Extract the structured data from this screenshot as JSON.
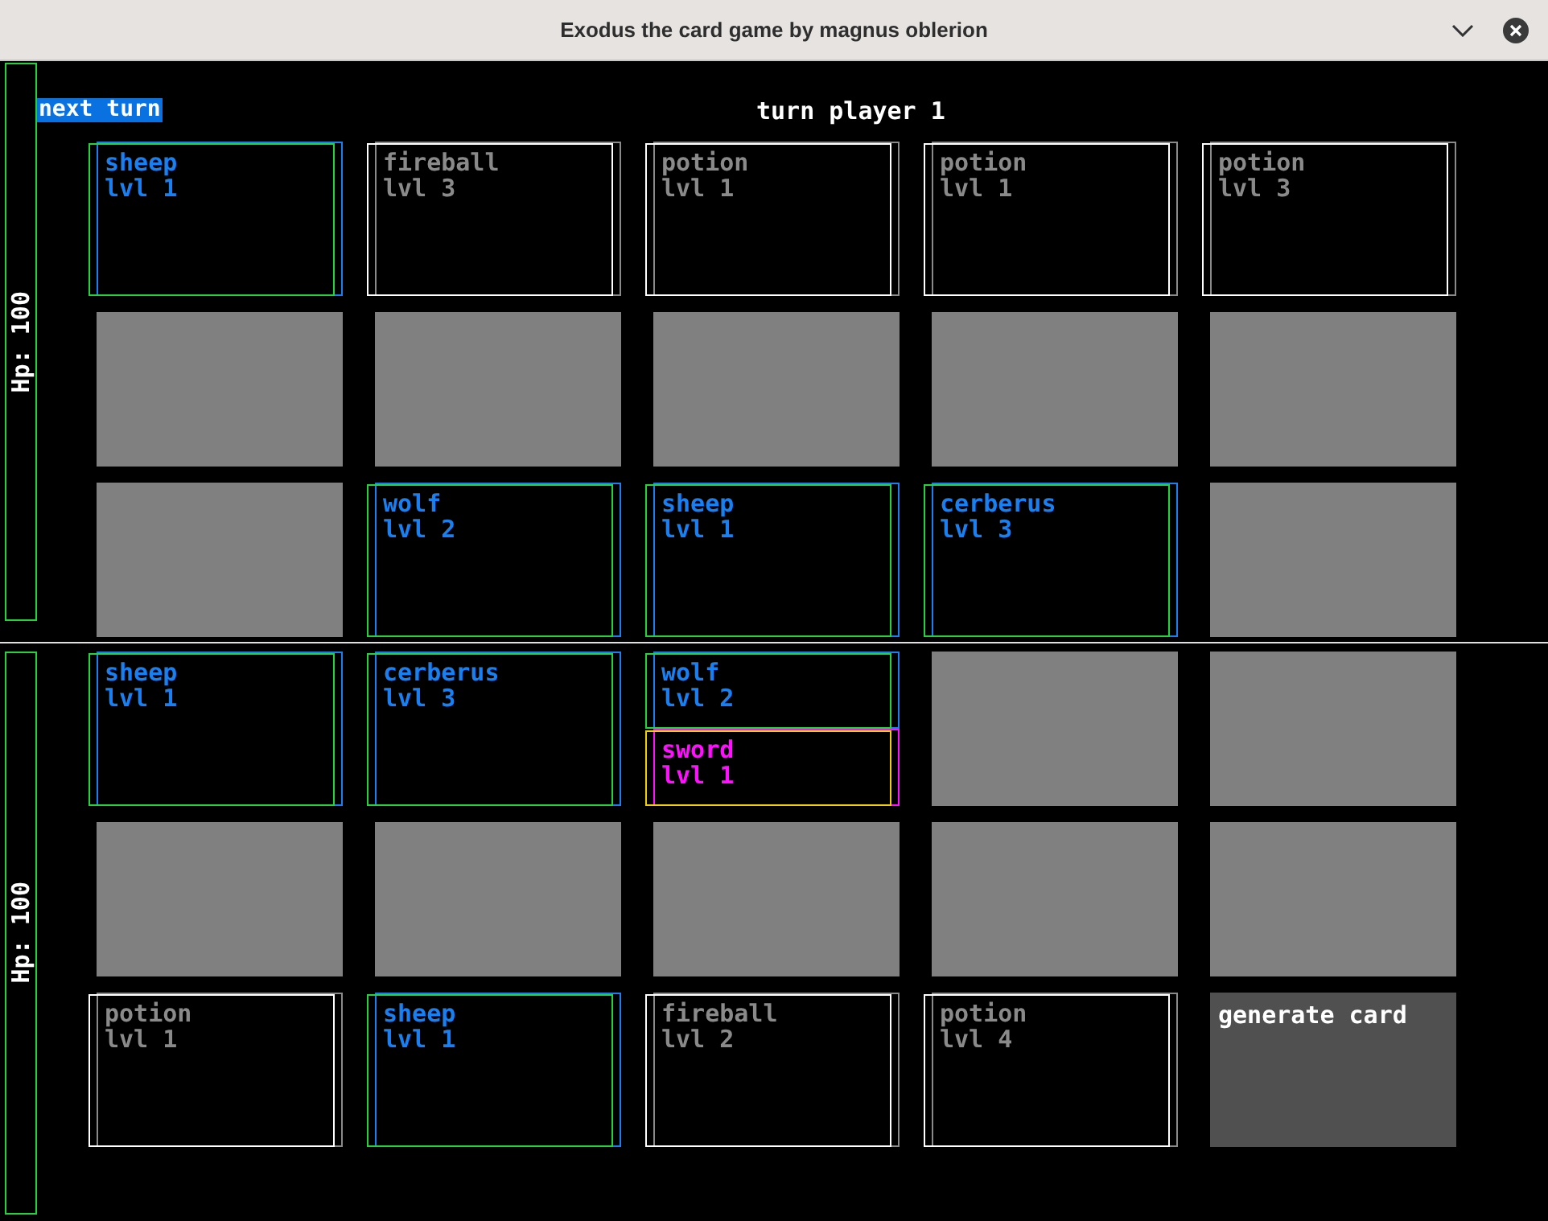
{
  "window": {
    "title": "Exodus the card game by magnus oblerion"
  },
  "next_turn_button": "next turn",
  "turn_label": "turn player 1",
  "players": [
    {
      "hp": "Hp: 100",
      "rows": [
        [
          {
            "kind": "cards",
            "cards": [
              {
                "kind": "creature",
                "name": "sheep",
                "level": "lvl 1"
              }
            ]
          },
          {
            "kind": "cards",
            "cards": [
              {
                "kind": "spell",
                "name": "fireball",
                "level": "lvl 3"
              }
            ]
          },
          {
            "kind": "cards",
            "cards": [
              {
                "kind": "spell",
                "name": "potion",
                "level": "lvl 1"
              }
            ]
          },
          {
            "kind": "cards",
            "cards": [
              {
                "kind": "spell",
                "name": "potion",
                "level": "lvl 1"
              }
            ]
          },
          {
            "kind": "cards",
            "cards": [
              {
                "kind": "spell",
                "name": "potion",
                "level": "lvl 3"
              }
            ]
          }
        ],
        [
          {
            "kind": "empty"
          },
          {
            "kind": "empty"
          },
          {
            "kind": "empty"
          },
          {
            "kind": "empty"
          },
          {
            "kind": "empty"
          }
        ],
        [
          {
            "kind": "empty"
          },
          {
            "kind": "cards",
            "cards": [
              {
                "kind": "creature",
                "name": "wolf",
                "level": "lvl 2"
              }
            ]
          },
          {
            "kind": "cards",
            "cards": [
              {
                "kind": "creature",
                "name": "sheep",
                "level": "lvl 1"
              }
            ]
          },
          {
            "kind": "cards",
            "cards": [
              {
                "kind": "creature",
                "name": "cerberus",
                "level": "lvl 3"
              }
            ]
          },
          {
            "kind": "empty"
          }
        ]
      ]
    },
    {
      "hp": "Hp: 100",
      "rows": [
        [
          {
            "kind": "cards",
            "cards": [
              {
                "kind": "creature",
                "name": "sheep",
                "level": "lvl 1"
              }
            ]
          },
          {
            "kind": "cards",
            "cards": [
              {
                "kind": "creature",
                "name": "cerberus",
                "level": "lvl 3"
              }
            ]
          },
          {
            "kind": "cards",
            "cards": [
              {
                "kind": "creature",
                "name": "wolf",
                "level": "lvl 2"
              },
              {
                "kind": "equipment",
                "name": "sword",
                "level": "lvl 1"
              }
            ]
          },
          {
            "kind": "empty"
          },
          {
            "kind": "empty"
          }
        ],
        [
          {
            "kind": "empty"
          },
          {
            "kind": "empty"
          },
          {
            "kind": "empty"
          },
          {
            "kind": "empty"
          },
          {
            "kind": "empty"
          }
        ],
        [
          {
            "kind": "cards",
            "cards": [
              {
                "kind": "spell",
                "name": "potion",
                "level": "lvl 1"
              }
            ]
          },
          {
            "kind": "cards",
            "cards": [
              {
                "kind": "creature",
                "name": "sheep",
                "level": "lvl 1"
              }
            ]
          },
          {
            "kind": "cards",
            "cards": [
              {
                "kind": "spell",
                "name": "fireball",
                "level": "lvl 2"
              }
            ]
          },
          {
            "kind": "cards",
            "cards": [
              {
                "kind": "spell",
                "name": "potion",
                "level": "lvl 4"
              }
            ]
          },
          {
            "kind": "button",
            "label": "generate card"
          }
        ]
      ]
    }
  ]
}
